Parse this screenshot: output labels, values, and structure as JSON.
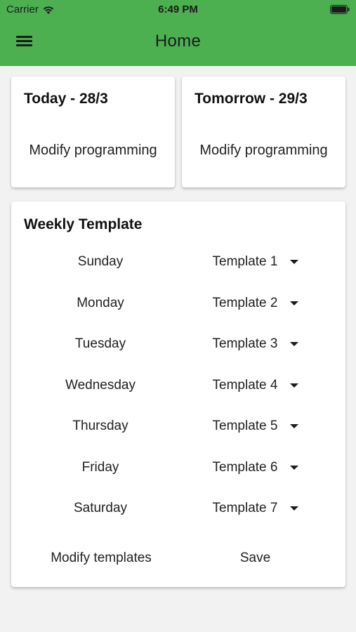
{
  "status_bar": {
    "carrier": "Carrier",
    "time": "6:49 PM"
  },
  "app_bar": {
    "title": "Home",
    "menu_icon": "hamburger-menu-icon"
  },
  "days": {
    "today": {
      "title": "Today - 28/3",
      "action": "Modify programming"
    },
    "tomorrow": {
      "title": "Tomorrow - 29/3",
      "action": "Modify programming"
    }
  },
  "weekly_template": {
    "title": "Weekly Template",
    "rows": [
      {
        "day": "Sunday",
        "template": "Template 1"
      },
      {
        "day": "Monday",
        "template": "Template 2"
      },
      {
        "day": "Tuesday",
        "template": "Template 3"
      },
      {
        "day": "Wednesday",
        "template": "Template 4"
      },
      {
        "day": "Thursday",
        "template": "Template 5"
      },
      {
        "day": "Friday",
        "template": "Template 6"
      },
      {
        "day": "Saturday",
        "template": "Template 7"
      }
    ],
    "modify_templates_label": "Modify templates",
    "save_label": "Save"
  },
  "colors": {
    "app_bar": "#4caf50",
    "background": "#f2f2f2",
    "card": "#ffffff"
  }
}
